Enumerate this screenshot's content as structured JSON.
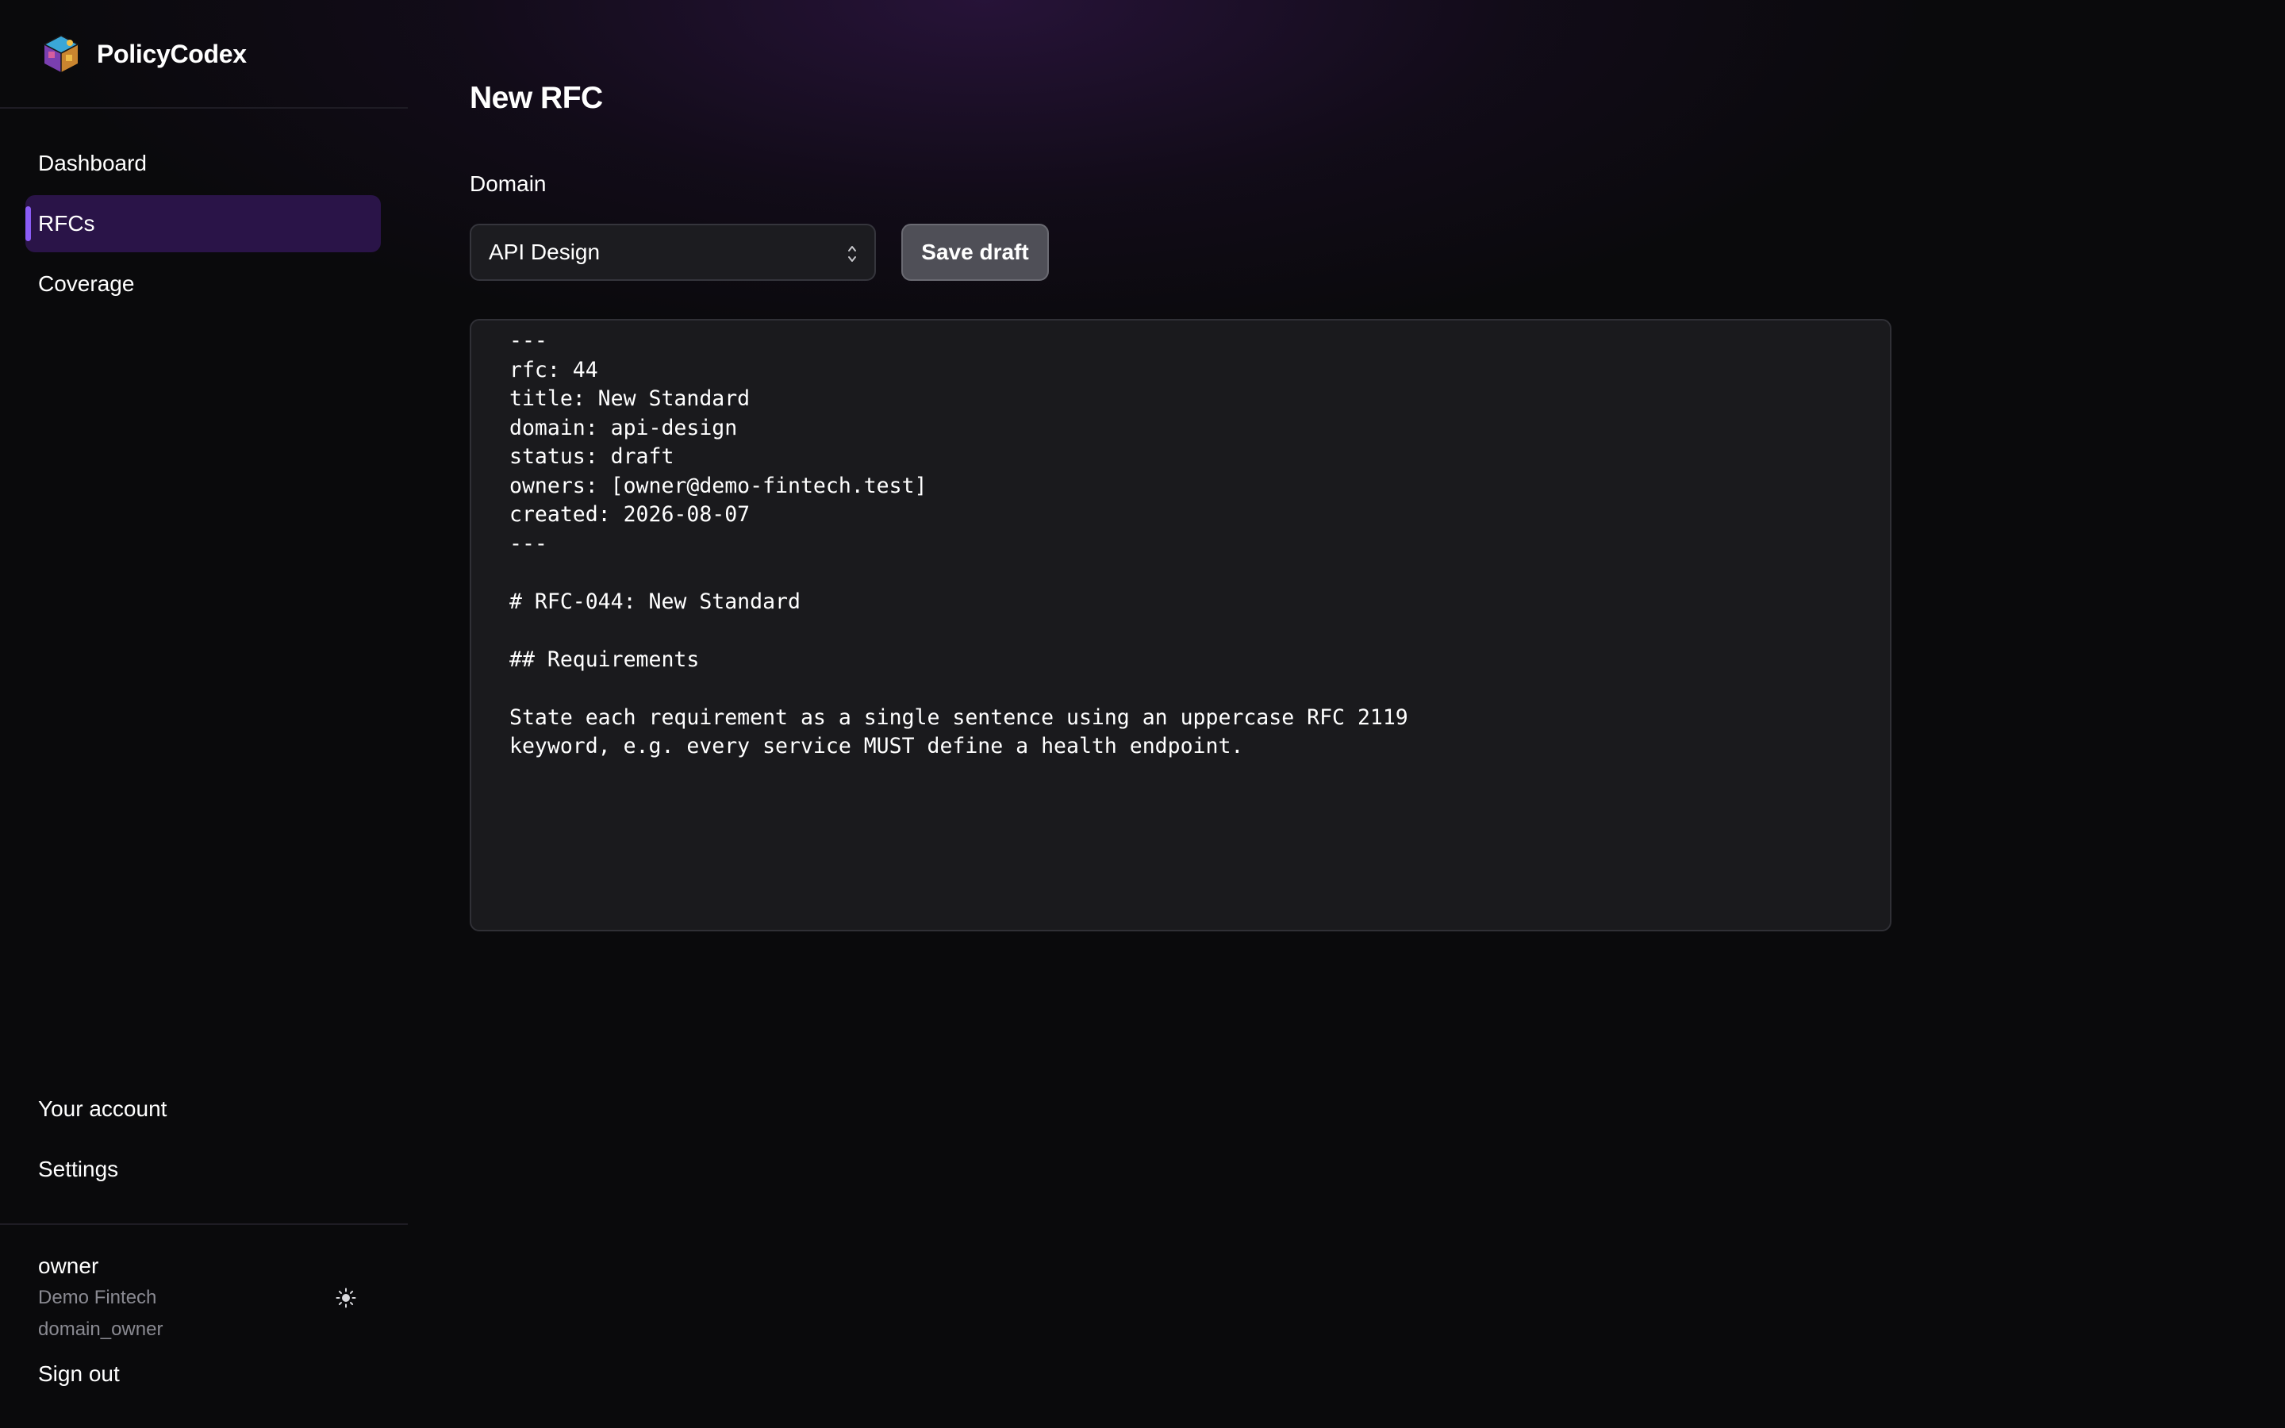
{
  "app": {
    "brand_name": "PolicyCodex",
    "logo_icon": "cube-logo-icon"
  },
  "sidebar": {
    "nav_items": [
      {
        "label": "Dashboard",
        "active": false
      },
      {
        "label": "RFCs",
        "active": true
      },
      {
        "label": "Coverage",
        "active": false
      }
    ],
    "bottom_items": [
      {
        "label": "Your account"
      },
      {
        "label": "Settings"
      }
    ],
    "user": {
      "name": "owner",
      "org": "Demo Fintech",
      "role": "domain_owner"
    },
    "theme_toggle_icon": "sun-icon",
    "sign_out_label": "Sign out"
  },
  "main": {
    "title": "New RFC",
    "domain_label": "Domain",
    "domain_select": {
      "value": "API Design",
      "icon": "chevron-up-down-icon"
    },
    "save_button_label": "Save draft",
    "editor_content": "---\nrfc: 44\ntitle: New Standard\ndomain: api-design\nstatus: draft\nowners: [owner@demo-fintech.test]\ncreated: 2026-08-07\n---\n\n# RFC-044: New Standard\n\n## Requirements\n\nState each requirement as a single sentence using an uppercase RFC 2119\nkeyword, e.g. every service MUST define a health endpoint."
  },
  "colors": {
    "accent": "#8b5cf6",
    "active_nav_bg": "#2a1448",
    "page_bg": "#0a0a0c",
    "editor_bg": "#1a1a1d",
    "button_bg": "#4f4f57"
  }
}
